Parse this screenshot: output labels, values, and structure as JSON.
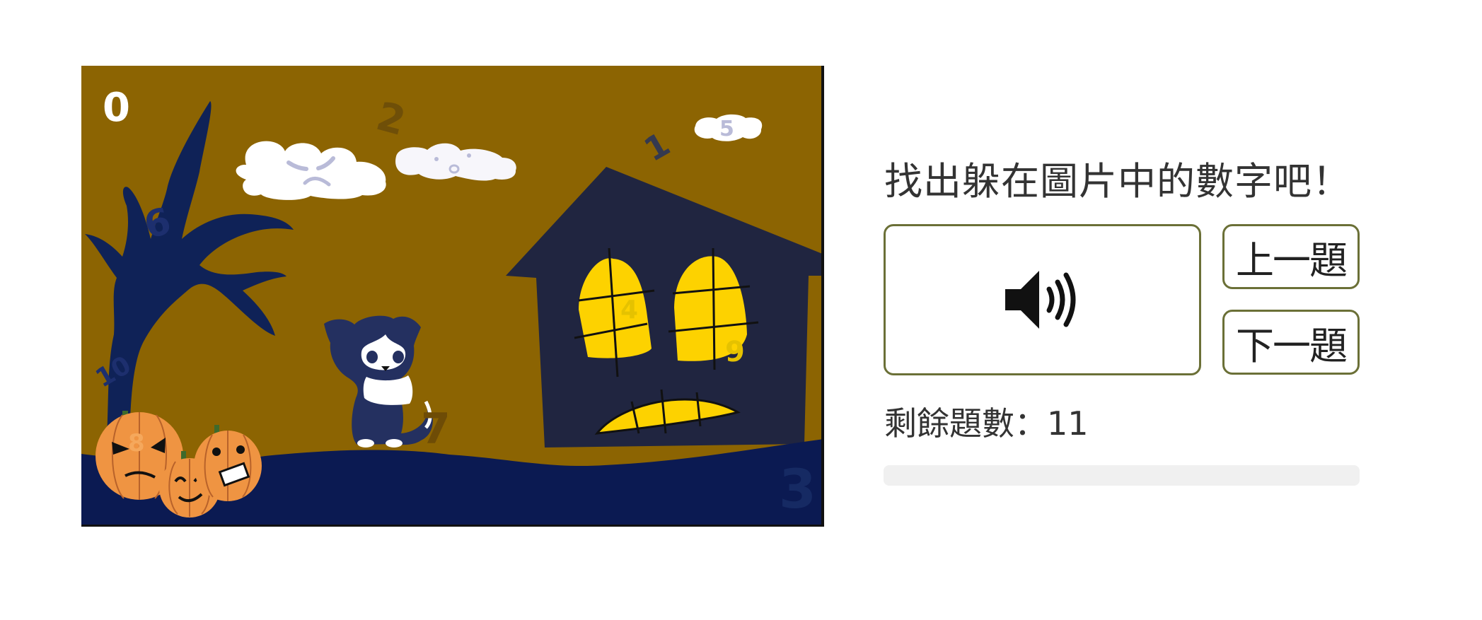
{
  "game": {
    "prompt": "找出躲在圖片中的數字吧！",
    "sound_button_icon": "speaker-icon",
    "prev_label": "上一題",
    "next_label": "下一題",
    "remaining_label": "剩餘題數：11",
    "progress_fraction": 0
  },
  "scene": {
    "hidden_numbers": [
      "0",
      "1",
      "2",
      "3",
      "4",
      "5",
      "6",
      "7",
      "8",
      "9",
      "10"
    ]
  },
  "colors": {
    "sky": "#8c6402",
    "ground": "#0b1a52",
    "house": "#202540",
    "window": "#fdd200",
    "tree": "#0f2257",
    "accent": "#6b7037"
  }
}
